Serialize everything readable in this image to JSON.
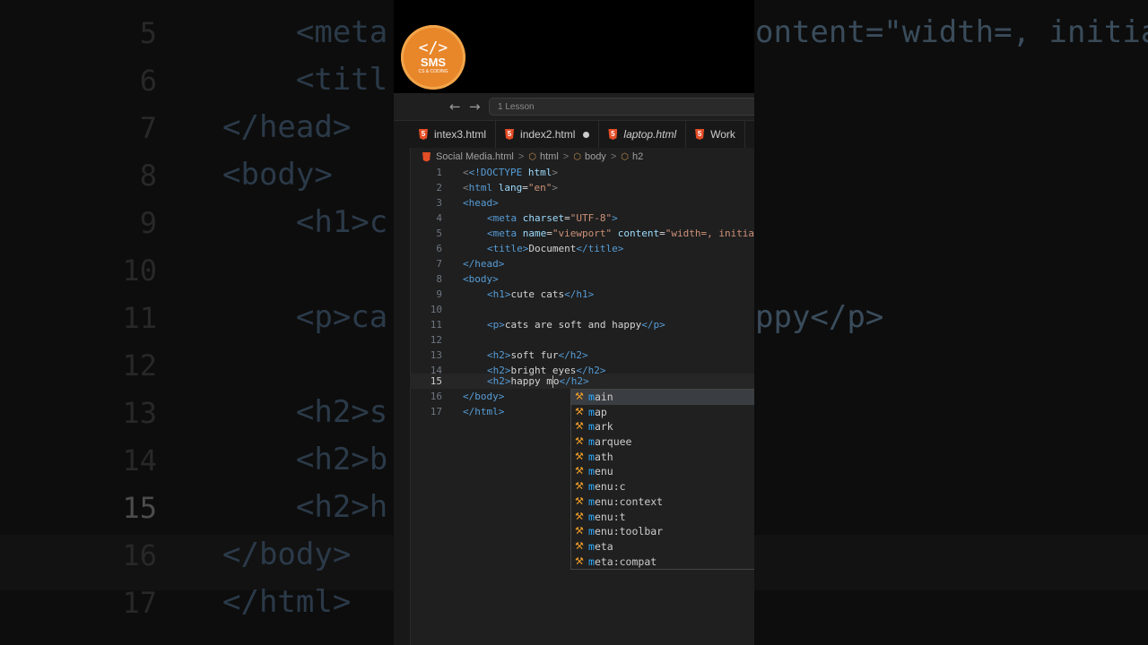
{
  "background_zoom": {
    "lines": [
      {
        "num": "5",
        "code": "    <meta",
        "right": "ontent=\"width=, initia"
      },
      {
        "num": "6",
        "code": "    <titl",
        "right": ""
      },
      {
        "num": "7",
        "code": "</head>",
        "right": ""
      },
      {
        "num": "8",
        "code": "<body>",
        "right": ""
      },
      {
        "num": "9",
        "code": "    <h1>c",
        "right": ""
      },
      {
        "num": "10",
        "code": "",
        "right": ""
      },
      {
        "num": "11",
        "code": "    <p>ca",
        "right": "ppy</p>"
      },
      {
        "num": "12",
        "code": "",
        "right": ""
      },
      {
        "num": "13",
        "code": "    <h2>s",
        "right": ""
      },
      {
        "num": "14",
        "code": "    <h2>b",
        "right": ""
      },
      {
        "num": "15",
        "code": "    <h2>h",
        "right": ""
      },
      {
        "num": "16",
        "code": "</body>",
        "right": ""
      },
      {
        "num": "17",
        "code": "</html>",
        "right": ""
      }
    ]
  },
  "logo": {
    "symbol": "</>",
    "title": "SMS",
    "subtitle": "CS & CODING"
  },
  "titlebar": {
    "back": "←",
    "forward": "→",
    "command_center": "1 Lesson"
  },
  "tabs": [
    {
      "label": "intex3.html",
      "modified": false,
      "italic": false
    },
    {
      "label": "index2.html",
      "modified": true,
      "italic": false
    },
    {
      "label": "laptop.html",
      "modified": false,
      "italic": true
    },
    {
      "label": "Work",
      "modified": false,
      "italic": false
    }
  ],
  "breadcrumb": {
    "file": "Social Media.html",
    "items": [
      "html",
      "body",
      "h2"
    ],
    "separator": ">"
  },
  "editor": {
    "current_line": "15",
    "line_numbers": [
      "1",
      "2",
      "3",
      "4",
      "5",
      "6",
      "7",
      "8",
      "9",
      "10",
      "11",
      "12",
      "13",
      "14",
      "15",
      "16",
      "17"
    ]
  },
  "code": {
    "l1": [
      "<!DOCTYPE ",
      "html",
      ">"
    ],
    "l2": [
      "<html ",
      "lang",
      "=",
      "\"en\"",
      ">"
    ],
    "l3": "<head>",
    "l4": [
      "<meta ",
      "charset",
      "=",
      "\"UTF-8\"",
      ">"
    ],
    "l5": [
      "<meta ",
      "name",
      "=",
      "\"viewport\"",
      " content",
      "=",
      "\"width=, initia"
    ],
    "l6": [
      "<title>",
      "Document",
      "</title>"
    ],
    "l7": "</head>",
    "l8": "<body>",
    "l9": [
      "<h1>",
      "cute cats",
      "</h1>"
    ],
    "l11": [
      "<p>",
      "cats are soft and happy",
      "</p>"
    ],
    "l13": [
      "<h2>",
      "soft fur",
      "</h2>"
    ],
    "l14": [
      "<h2>",
      "bright eyes",
      "</h2>"
    ],
    "l15": [
      "<h2>",
      "happy m",
      "o",
      "</h2>"
    ],
    "l16": "</body>",
    "l17": "</html>"
  },
  "suggestions": [
    {
      "match": "m",
      "rest": "ain"
    },
    {
      "match": "m",
      "rest": "ap"
    },
    {
      "match": "m",
      "rest": "ark"
    },
    {
      "match": "m",
      "rest": "arquee"
    },
    {
      "match": "m",
      "rest": "ath"
    },
    {
      "match": "m",
      "rest": "enu"
    },
    {
      "match": "m",
      "rest": "enu:c"
    },
    {
      "match": "m",
      "rest": "enu:context"
    },
    {
      "match": "m",
      "rest": "enu:t"
    },
    {
      "match": "m",
      "rest": "enu:toolbar"
    },
    {
      "match": "m",
      "rest": "eta"
    },
    {
      "match": "m",
      "rest": "eta:compat"
    }
  ],
  "colors": {
    "tag": "#569cd6",
    "attr": "#9cdcfe",
    "string": "#ce9178",
    "accent": "#e8862a",
    "match": "#2aaaff",
    "wrench": "#ee9d28"
  },
  "icons": {
    "suggestion": "wrench-icon",
    "tab_file": "html5-icon",
    "breadcrumb_node": "cube-icon"
  }
}
